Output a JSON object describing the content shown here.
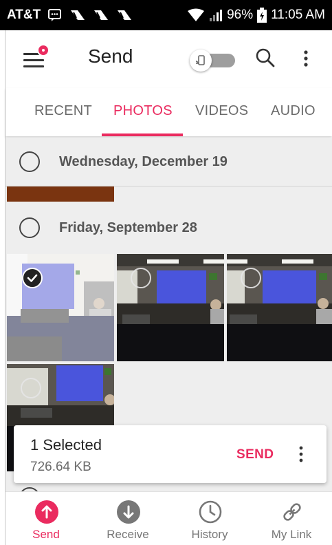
{
  "status_bar": {
    "carrier": "AT&T",
    "battery": "96%",
    "time": "11:05 AM",
    "icons": [
      "message-icon",
      "notification-icon",
      "notification-icon",
      "notification-icon",
      "wifi-icon",
      "signal-icon",
      "battery-icon"
    ]
  },
  "app_bar": {
    "title": "Send",
    "icons": [
      "menu-icon",
      "toggle-switch",
      "search-icon",
      "more-vert-icon"
    ]
  },
  "tabs": [
    {
      "label": "RECENT",
      "active": false
    },
    {
      "label": "PHOTOS",
      "active": true
    },
    {
      "label": "VIDEOS",
      "active": false
    },
    {
      "label": "AUDIO",
      "active": false
    }
  ],
  "groups": [
    {
      "date": "Wednesday, December 19",
      "photos": 1
    },
    {
      "date": "Friday, September 28",
      "photos": 4,
      "selected_photo_index": 0
    }
  ],
  "selection": {
    "count_label": "1 Selected",
    "size": "726.64 KB",
    "send_label": "SEND"
  },
  "bottom_nav": [
    {
      "label": "Send",
      "icon": "upload-icon",
      "active": true
    },
    {
      "label": "Receive",
      "icon": "download-icon",
      "active": false
    },
    {
      "label": "History",
      "icon": "clock-icon",
      "active": false
    },
    {
      "label": "My Link",
      "icon": "link-icon",
      "active": false
    }
  ],
  "colors": {
    "accent": "#ea2b5f",
    "content_bg": "#eeeeee"
  }
}
